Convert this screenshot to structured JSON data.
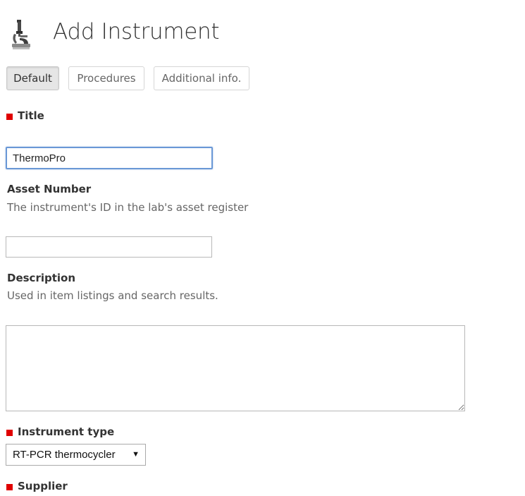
{
  "header": {
    "title": "Add Instrument",
    "icon": "microscope-icon"
  },
  "tabs": [
    {
      "label": "Default",
      "selected": true
    },
    {
      "label": "Procedures",
      "selected": false
    },
    {
      "label": "Additional info.",
      "selected": false
    }
  ],
  "colors": {
    "required_marker": "#e00000",
    "focus_border": "#6a98d6",
    "selected_tab_bg": "#e6e6e6"
  },
  "form": {
    "title": {
      "label": "Title",
      "required": true,
      "value": "ThermoPro"
    },
    "asset_number": {
      "label": "Asset Number",
      "help": "The instrument's ID in the lab's asset register",
      "value": ""
    },
    "description": {
      "label": "Description",
      "help": "Used in item listings and search results.",
      "value": ""
    },
    "instrument_type": {
      "label": "Instrument type",
      "required": true,
      "selected": "RT-PCR thermocycler"
    },
    "supplier": {
      "label": "Supplier",
      "required": true
    }
  }
}
